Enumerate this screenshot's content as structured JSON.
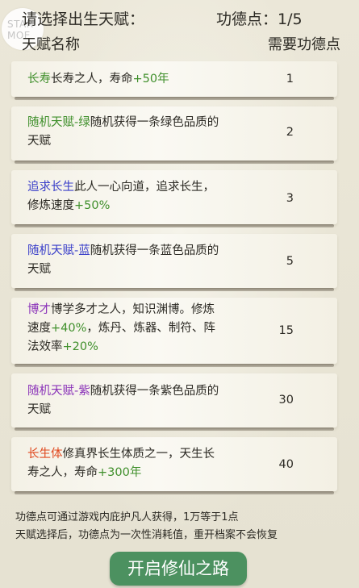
{
  "logo": {
    "line1": "STAR",
    "line2": "MOE"
  },
  "header": {
    "title": "请选择出生天赋：",
    "merit_label": "功德点：",
    "merit_value": "1/5",
    "col_name": "天赋名称",
    "col_cost": "需要功德点"
  },
  "talents": [
    {
      "name": "长寿",
      "name_color": "green",
      "line1_pre": "长寿之人，寿命",
      "line1_val": "+50年",
      "line2_pre": "",
      "line2_val": "",
      "line2_post": "",
      "line3_pre": "",
      "line3_val": "",
      "cost": "1"
    },
    {
      "name": "随机天赋-绿",
      "name_color": "green",
      "line1_pre": "随机获得一条绿色品质的",
      "line1_val": "",
      "line2_pre": "天赋",
      "line2_val": "",
      "line2_post": "",
      "line3_pre": "",
      "line3_val": "",
      "cost": "2"
    },
    {
      "name": "追求长生",
      "name_color": "blue",
      "line1_pre": "此人一心向道，追求长生，",
      "line1_val": "",
      "line2_pre": "修炼速度",
      "line2_val": "+50%",
      "line2_post": "",
      "line3_pre": "",
      "line3_val": "",
      "cost": "3"
    },
    {
      "name": "随机天赋-蓝",
      "name_color": "blue",
      "line1_pre": "随机获得一条蓝色品质的",
      "line1_val": "",
      "line2_pre": "天赋",
      "line2_val": "",
      "line2_post": "",
      "line3_pre": "",
      "line3_val": "",
      "cost": "5"
    },
    {
      "name": "博才",
      "name_color": "purple",
      "line1_pre": "博学多才之人，知识渊博。修炼",
      "line1_val": "",
      "line2_pre": "速度",
      "line2_val": "+40%",
      "line2_post": "，炼丹、炼器、制符、阵",
      "line3_pre": "法效率",
      "line3_val": "+20%",
      "cost": "15"
    },
    {
      "name": "随机天赋-紫",
      "name_color": "purple",
      "line1_pre": "随机获得一条紫色品质的",
      "line1_val": "",
      "line2_pre": "天赋",
      "line2_val": "",
      "line2_post": "",
      "line3_pre": "",
      "line3_val": "",
      "cost": "30"
    },
    {
      "name": "长生体",
      "name_color": "red",
      "line1_pre": "修真界长生体质之一，天生长",
      "line1_val": "",
      "line2_pre": "寿之人，寿命",
      "line2_val": "+300年",
      "line2_post": "",
      "line3_pre": "",
      "line3_val": "",
      "cost": "40"
    }
  ],
  "footer": {
    "note1": "功德点可通过游戏内庇护凡人获得，1万等于1点",
    "note2": "天赋选择后，功德点为一次性消耗值，重开档案不会恢复"
  },
  "start_button": "开启修仙之路",
  "colors": {
    "background": "#e9e5d6",
    "green": "#3f8f2b",
    "blue": "#3a3fc9",
    "purple": "#8a32b8",
    "red": "#e0491f",
    "button": "#4c9160"
  }
}
